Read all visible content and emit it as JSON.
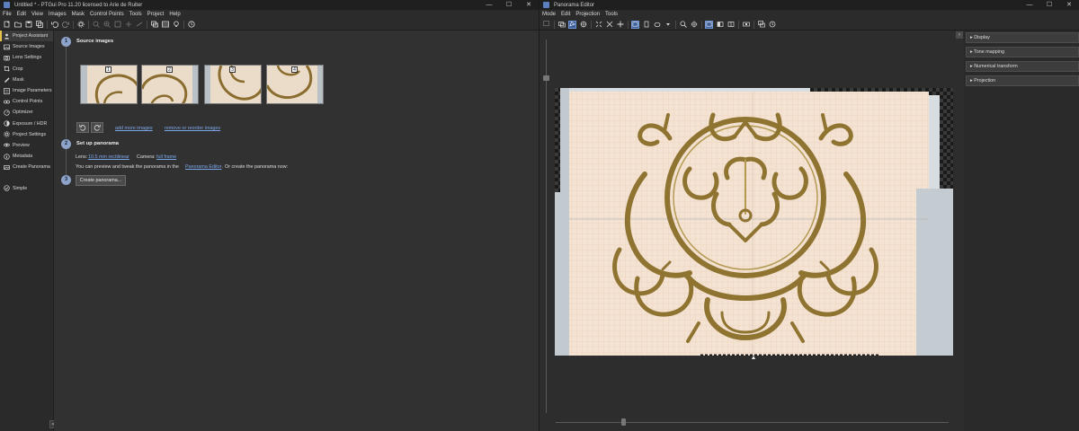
{
  "left_window": {
    "title": "Untitled * - PTGui Pro 11.20 licensed to Arie de Ruiter",
    "window_controls": [
      "—",
      "☐",
      "✕"
    ],
    "menu": [
      "File",
      "Edit",
      "View",
      "Images",
      "Mask",
      "Control Points",
      "Tools",
      "Project",
      "Help"
    ],
    "toolbar_icons": [
      "new-project-icon",
      "open-icon",
      "save-icon",
      "save-all-icon",
      "undo-icon",
      "redo-icon",
      "settings-icon",
      "zoom-out-icon",
      "zoom-in-icon",
      "zoom-fit-icon",
      "zoom-100-icon",
      "link-icon",
      "panorama-editor-icon",
      "table-icon",
      "light-icon",
      "help-icon"
    ],
    "sidebar": {
      "items": [
        {
          "label": "Project Assistant",
          "icon": "assistant-icon",
          "active": true
        },
        {
          "label": "Source Images",
          "icon": "images-icon"
        },
        {
          "label": "Lens Settings",
          "icon": "lens-icon"
        },
        {
          "label": "Crop",
          "icon": "crop-icon"
        },
        {
          "label": "Mask",
          "icon": "mask-icon"
        },
        {
          "label": "Image Parameters",
          "icon": "parameters-icon"
        },
        {
          "label": "Control Points",
          "icon": "control-points-icon"
        },
        {
          "label": "Optimizer",
          "icon": "optimizer-icon"
        },
        {
          "label": "Exposure / HDR",
          "icon": "exposure-icon"
        },
        {
          "label": "Project Settings",
          "icon": "gear-icon"
        },
        {
          "label": "Preview",
          "icon": "eye-icon"
        },
        {
          "label": "Metadata",
          "icon": "metadata-icon"
        },
        {
          "label": "Create Panorama",
          "icon": "create-panorama-icon"
        }
      ],
      "simple": {
        "label": "Simple",
        "icon": "simple-icon"
      },
      "collapse_label": "«"
    },
    "assistant": {
      "step1": {
        "num": "1",
        "title": "Source images"
      },
      "thumbnails": [
        "1",
        "2",
        "3",
        "4"
      ],
      "rotate_left_icon": "rotate-left-icon",
      "rotate_right_icon": "rotate-right-icon",
      "add_more_link": "add more images",
      "remove_link": "remove or reorder images",
      "step2": {
        "num": "2",
        "title": "Set up panorama"
      },
      "lens_label": "Lens:",
      "lens_value": "10.5 mm rectilinear",
      "camera_label": "Camera:",
      "camera_value": "full frame",
      "preview_text_1": "You can preview and tweak the panorama in the",
      "preview_link": "Panorama Editor",
      "preview_text_2": ". Or create the panorama now:",
      "step3": {
        "num": "3"
      },
      "create_button": "Create panorama..."
    }
  },
  "right_window": {
    "title": "Panorama Editor",
    "window_controls": [
      "—",
      "☐",
      "✕"
    ],
    "menu": [
      "Mode",
      "Edit",
      "Projection",
      "Tools"
    ],
    "toolbar_icons": [
      "pointer-icon",
      "drag-icon",
      "rotate-icon",
      "center-icon",
      "straighten-icon",
      "align-icon",
      "fit-icon",
      "numerical-icon",
      "crop-icon",
      "mask-icon",
      "blend-icon",
      "dropdown-icon",
      "zoom-icon",
      "grid-icon",
      "view-normal-icon",
      "view-split-icon",
      "view-mirror-icon",
      "compare-icon",
      "layers-icon",
      "settings-icon"
    ],
    "panels_toggle": "›",
    "panels": [
      "▸ Display",
      "▸ Tone mapping",
      "▸ Numerical transform",
      "▸ Projection"
    ]
  },
  "colors": {
    "accent_blue": "#7ba6ea",
    "active_marker": "#e8c04d",
    "brass": "#a8904a"
  }
}
